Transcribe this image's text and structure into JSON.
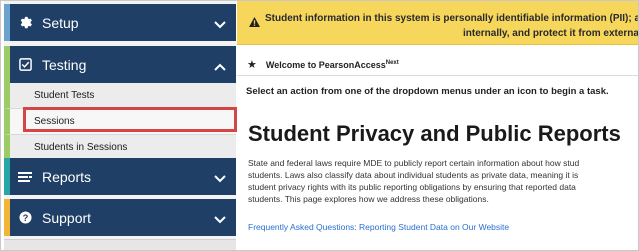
{
  "sidebar": {
    "setup": {
      "label": "Setup",
      "icon": "gear-icon"
    },
    "testing": {
      "label": "Testing",
      "icon": "checkbox-icon",
      "items": [
        {
          "label": "Student Tests"
        },
        {
          "label": "Sessions"
        },
        {
          "label": "Students in Sessions"
        }
      ]
    },
    "reports": {
      "label": "Reports",
      "icon": "report-icon"
    },
    "support": {
      "label": "Support",
      "icon": "question-icon"
    }
  },
  "alert": {
    "line1": "Student information in this system is personally identifiable information (PII); a",
    "line2": "internally, and protect it from external a"
  },
  "welcome": {
    "text": "Welcome to PearsonAccess",
    "superscript": "Next"
  },
  "instruction": "Select an action from one of the dropdown menus under an icon to begin a task.",
  "heading": "Student Privacy and Public Reports",
  "paragraph": [
    "State and federal laws require MDE to publicly report certain information about how stud",
    "students. Laws also classify data about individual students as private data, meaning it is",
    "student privacy rights with its public reporting obligations by ensuring that reported data",
    "students. This page explores how we address these obligations."
  ],
  "faq_link": "Frequently Asked Questions: Reporting Student Data on Our Website",
  "colors": {
    "nav_dark": "#1f3f66",
    "setup_accent": "#6ba3cf",
    "testing_accent": "#9ccc65",
    "reports_accent": "#26a6a6",
    "support_accent": "#f2b634",
    "alert_bg": "#f6d75c",
    "highlight": "#d64545",
    "link": "#2a6fd1"
  }
}
